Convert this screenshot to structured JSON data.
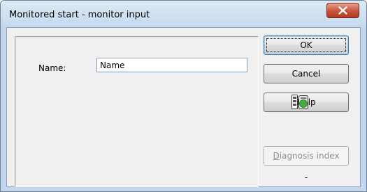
{
  "window": {
    "title": "Monitored start - monitor input"
  },
  "form": {
    "name_label": "Name:",
    "name_value": "Name"
  },
  "buttons": {
    "ok_label": "OK",
    "cancel_label": "Cancel",
    "help_prefix": "",
    "help_mnemonic": "H",
    "help_rest": "elp",
    "diagnosis_mnemonic": "D",
    "diagnosis_rest": "iagnosis index"
  },
  "diagnosis": {
    "value": "-",
    "icon": "diagnosis-status-icon"
  },
  "colors": {
    "close_button": "#c8523a",
    "titlebar": "#c5d9ee",
    "client_background": "#f0f0f0",
    "status_icon_green": "#3fae3a"
  }
}
